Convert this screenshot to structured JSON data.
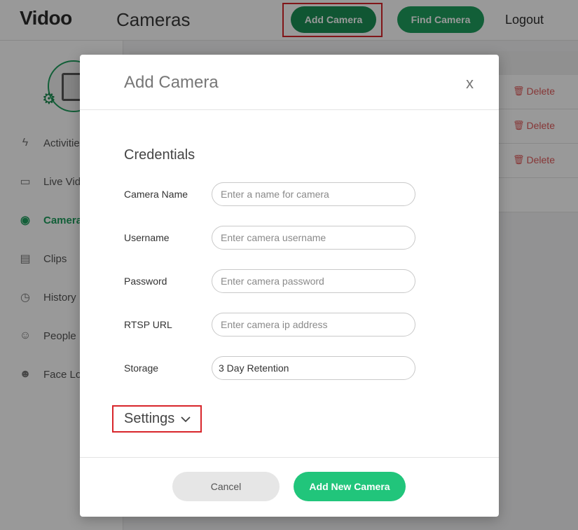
{
  "app": {
    "logo": "Vidoo",
    "page_title": "Cameras",
    "add_camera_label": "Add Camera",
    "find_camera_label": "Find Camera",
    "logout_label": "Logout"
  },
  "sidebar": {
    "items": [
      {
        "label": "Activities",
        "icon": "lightning-icon"
      },
      {
        "label": "Live Video",
        "icon": "video-camera-icon"
      },
      {
        "label": "Cameras",
        "icon": "camera-icon",
        "active": true
      },
      {
        "label": "Clips",
        "icon": "clapperboard-icon"
      },
      {
        "label": "History",
        "icon": "clock-icon"
      },
      {
        "label": "People",
        "icon": "people-icon"
      },
      {
        "label": "Face Log",
        "icon": "face-scan-icon"
      }
    ]
  },
  "table": {
    "delete_label": "Delete"
  },
  "modal": {
    "title": "Add Camera",
    "close_label": "x",
    "section_title": "Credentials",
    "fields": [
      {
        "label": "Camera Name",
        "placeholder": "Enter a name for camera",
        "value": ""
      },
      {
        "label": "Username",
        "placeholder": "Enter camera username",
        "value": ""
      },
      {
        "label": "Password",
        "placeholder": "Enter camera password",
        "value": ""
      },
      {
        "label": "RTSP URL",
        "placeholder": "Enter camera ip address",
        "value": ""
      },
      {
        "label": "Storage",
        "placeholder": "",
        "value": "3 Day Retention"
      }
    ],
    "settings_label": "Settings",
    "cancel_label": "Cancel",
    "submit_label": "Add New Camera"
  },
  "colors": {
    "brand_green": "#1f9e5e",
    "submit_green": "#21c57b",
    "highlight_red": "#d8262b",
    "delete_red": "#e05b5b"
  }
}
